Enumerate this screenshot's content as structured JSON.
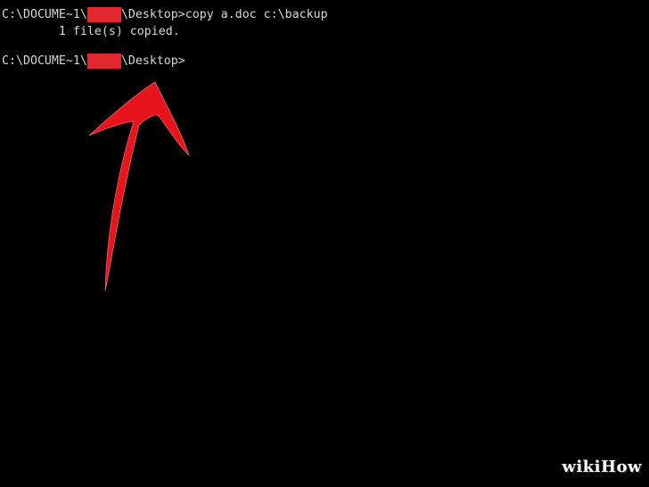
{
  "console": {
    "line1": {
      "prefix": "C:\\DOCUME~1\\",
      "suffix": "\\Desktop>copy a.doc c:\\backup"
    },
    "line2": "        1 file(s) copied.",
    "line3": {
      "prefix": "C:\\DOCUME~1\\",
      "suffix": "\\Desktop>"
    }
  },
  "annotation": {
    "icon": "arrow-up-icon",
    "color": "#e8141c"
  },
  "watermark": {
    "wiki": "wiki",
    "how": "How"
  },
  "colors": {
    "background": "#000000",
    "text": "#d8d8d8",
    "redaction": "#e0282e"
  }
}
